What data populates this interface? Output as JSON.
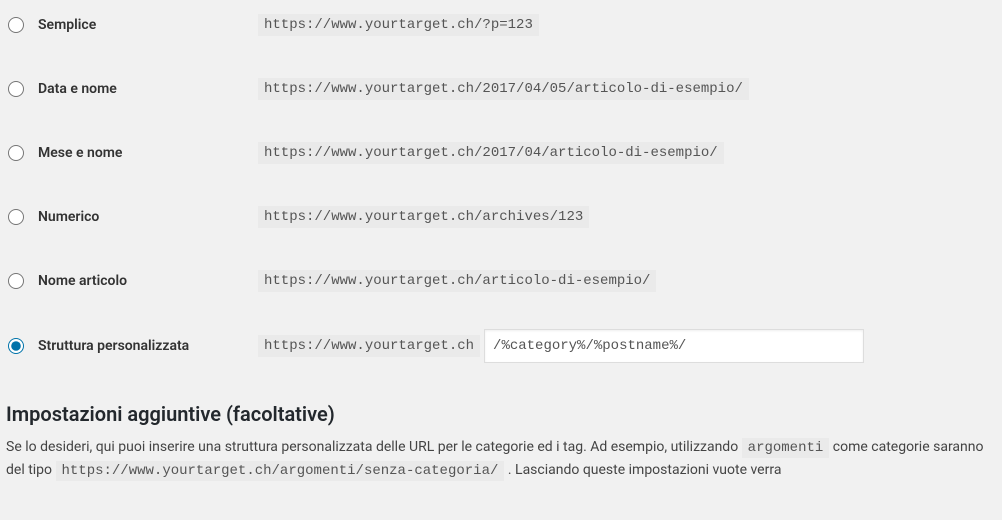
{
  "permalinks": {
    "options": [
      {
        "label": "Semplice",
        "example": "https://www.yourtarget.ch/?p=123",
        "selected": false
      },
      {
        "label": "Data e nome",
        "example": "https://www.yourtarget.ch/2017/04/05/articolo-di-esempio/",
        "selected": false
      },
      {
        "label": "Mese e nome",
        "example": "https://www.yourtarget.ch/2017/04/articolo-di-esempio/",
        "selected": false
      },
      {
        "label": "Numerico",
        "example": "https://www.yourtarget.ch/archives/123",
        "selected": false
      },
      {
        "label": "Nome articolo",
        "example": "https://www.yourtarget.ch/articolo-di-esempio/",
        "selected": false
      },
      {
        "label": "Struttura personalizzata",
        "prefix": "https://www.yourtarget.ch",
        "value": "/%category%/%postname%/",
        "selected": true
      }
    ]
  },
  "optional": {
    "heading": "Impostazioni aggiuntive (facoltative)",
    "desc_part1": "Se lo desideri, qui puoi inserire una struttura personalizzata delle URL per le categorie ed i tag. Ad esempio, utilizzando ",
    "desc_code1": "argomenti",
    "desc_part2": " come categorie saranno del tipo ",
    "desc_code2": "https://www.yourtarget.ch/argomenti/senza-categoria/",
    "desc_part3": " . Lasciando queste impostazioni vuote verra"
  }
}
